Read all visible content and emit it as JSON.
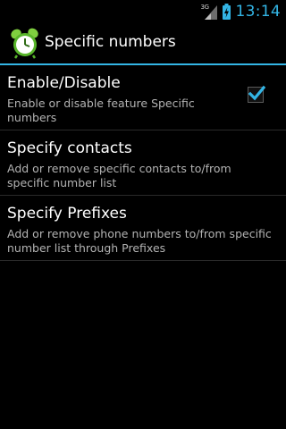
{
  "status_bar": {
    "network_type": "3G",
    "time": "13:14",
    "icons": [
      "signal-icon",
      "battery-charging-icon"
    ]
  },
  "action_bar": {
    "title": "Specific numbers",
    "icon": "alarm-clock-app-icon"
  },
  "preferences": [
    {
      "title": "Enable/Disable",
      "summary": "Enable or disable feature Specific numbers",
      "checked": true
    },
    {
      "title": "Specify contacts",
      "summary": "Add or remove specific contacts to/from specific number list"
    },
    {
      "title": "Specify Prefixes",
      "summary": "Add or remove phone numbers to/from specific number list through Prefixes"
    }
  ],
  "colors": {
    "accent": "#33b5e5",
    "background": "#000000",
    "title_text": "#ffffff",
    "summary_text": "#b3b3b3"
  }
}
